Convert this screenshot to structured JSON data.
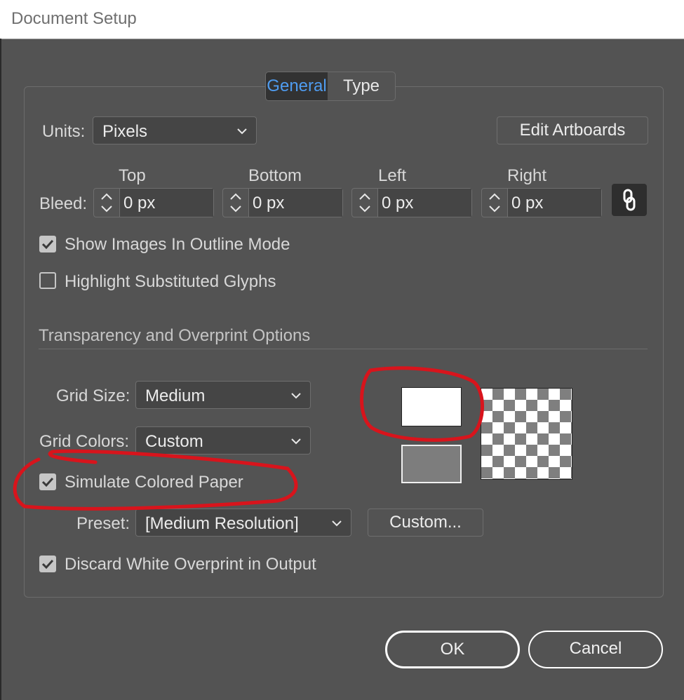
{
  "window": {
    "title": "Document Setup"
  },
  "tabs": [
    {
      "label": "General",
      "active": true
    },
    {
      "label": "Type",
      "active": false
    }
  ],
  "units": {
    "label": "Units:",
    "value": "Pixels"
  },
  "edit_artboards": {
    "label": "Edit Artboards"
  },
  "bleed": {
    "label": "Bleed:",
    "fields": [
      {
        "name": "Top",
        "value": "0 px"
      },
      {
        "name": "Bottom",
        "value": "0 px"
      },
      {
        "name": "Left",
        "value": "0 px"
      },
      {
        "name": "Right",
        "value": "0 px"
      }
    ]
  },
  "options": {
    "show_images_outline": {
      "label": "Show Images In Outline Mode",
      "checked": true
    },
    "highlight_glyphs": {
      "label": "Highlight Substituted Glyphs",
      "checked": false
    }
  },
  "transparency": {
    "section_title": "Transparency and Overprint Options",
    "grid_size": {
      "label": "Grid Size:",
      "value": "Medium"
    },
    "grid_colors": {
      "label": "Grid Colors:",
      "value": "Custom"
    },
    "simulate_paper": {
      "label": "Simulate Colored Paper",
      "checked": true
    },
    "preset": {
      "label": "Preset:",
      "value": "[Medium Resolution]"
    },
    "custom_button": {
      "label": "Custom..."
    },
    "discard_white": {
      "label": "Discard White Overprint in Output",
      "checked": true
    },
    "swatches": {
      "top_color": "#ffffff",
      "bottom_color": "#7d7d7d"
    }
  },
  "footer": {
    "ok_label": "OK",
    "cancel_label": "Cancel"
  },
  "colors": {
    "accent_tab": "#4f9cf0",
    "annotation": "#d8141c",
    "background": "#535353"
  }
}
